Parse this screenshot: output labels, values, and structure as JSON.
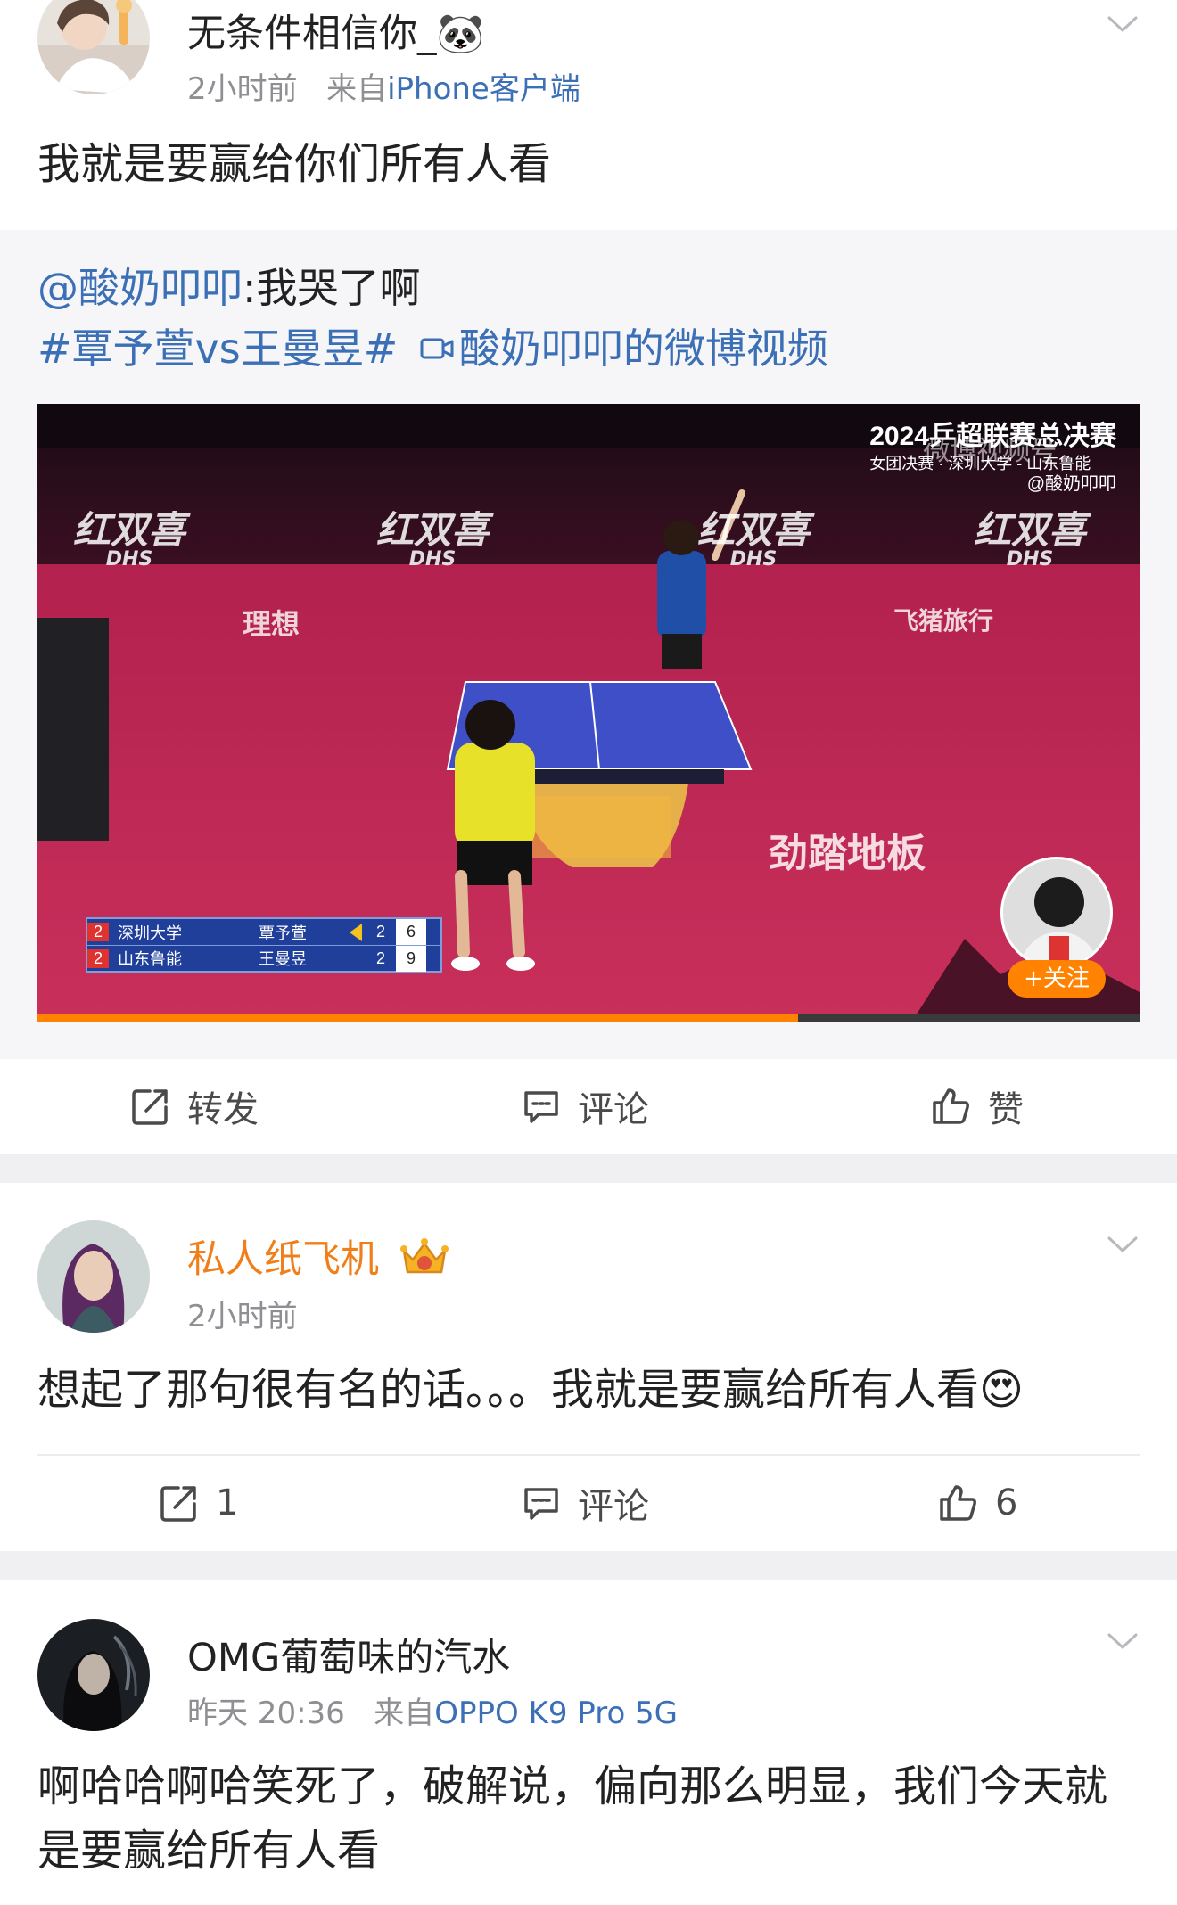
{
  "posts": [
    {
      "username": "无条件相信你_🐼",
      "time": "2小时前",
      "source_prefix": "来自",
      "source": "iPhone客户端",
      "text": "我就是要赢给你们所有人看",
      "repost": {
        "mention": "@酸奶叩叩",
        "mention_text": ":我哭了啊",
        "hashtag": "#覃予萱vs王曼昱#",
        "video_link": "酸奶叩叩的微博视频",
        "video": {
          "watermark_title": "2024乒超联赛总决赛",
          "watermark_sub": "女团决赛 · 深圳大学 - 山东鲁能",
          "watermark_brand": "微博视频号",
          "watermark_handle": "@酸奶叩叩",
          "sponsor_logos": [
            "红双喜",
            "红双喜",
            "红双喜",
            "红双喜"
          ],
          "sponsor_sub": "DHS",
          "banner_left": "理想",
          "banner_right": "飞猪旅行",
          "floor_text": "劲踏地板",
          "scoreboard": [
            {
              "seed": "2",
              "team": "深圳大学",
              "player": "覃予萱",
              "games": "2",
              "points": "6"
            },
            {
              "seed": "2",
              "team": "山东鲁能",
              "player": "王曼昱",
              "games": "2",
              "points": "9"
            }
          ],
          "follow_label": "+关注",
          "progress": 0.69
        }
      },
      "actions": {
        "repost": "转发",
        "comment": "评论",
        "like": "赞"
      }
    },
    {
      "username": "私人纸飞机",
      "time": "2小时前",
      "text": "想起了那句很有名的话。。。我就是要赢给所有人看😍",
      "actions": {
        "repost": "1",
        "comment": "评论",
        "like": "6"
      }
    },
    {
      "username": "OMG葡萄味的汽水",
      "time": "昨天 20:36",
      "source_prefix": "来自",
      "source": "OPPO K9 Pro 5G",
      "text": "啊哈哈啊哈笑死了，破解说，偏向那么明显，我们今天就是要赢给所有人看"
    }
  ],
  "colors": {
    "link": "#3b6fb6",
    "vip_name": "#f07f1a",
    "accent_orange": "#ff8200",
    "meta_gray": "#8e8e93"
  },
  "icons": [
    "chevron-down-icon",
    "repost-icon",
    "comment-icon",
    "like-icon",
    "crown-badge-icon",
    "video-link-icon"
  ]
}
